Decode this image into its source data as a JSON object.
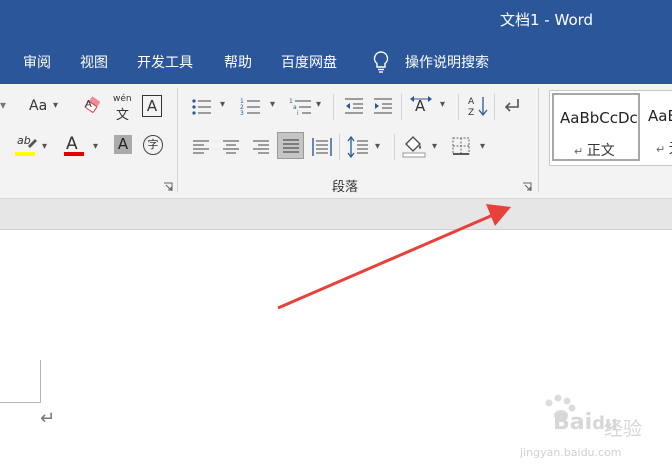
{
  "window": {
    "title": "文档1  -  Word"
  },
  "menu": {
    "items": [
      "审阅",
      "视图",
      "开发工具",
      "帮助",
      "百度网盘"
    ],
    "tell_me": "操作说明搜索"
  },
  "ribbon": {
    "font_group": {
      "change_case_label": "Aa",
      "phonetic_top": "wén",
      "phonetic_bottom": "文",
      "border_char": "A",
      "font_color_char": "A",
      "shading_char": "A",
      "enclose_char": "字",
      "highlight_label": "ab"
    },
    "paragraph_group": {
      "label": "段落"
    },
    "styles": {
      "normal_sample": "AaBbCcDc",
      "normal_name": "正文",
      "second_sample": "AaB",
      "second_name": "无"
    }
  },
  "document": {
    "paragraph_mark": "↵"
  },
  "watermark": {
    "brand": "Bai",
    "brand2": "du",
    "text": "经验",
    "url": "jingyan.baidu.com"
  },
  "colors": {
    "titlebar": "#2b579a",
    "arrow": "#e8413a",
    "highlight": "#ffff00",
    "font_color": "#e00000"
  }
}
